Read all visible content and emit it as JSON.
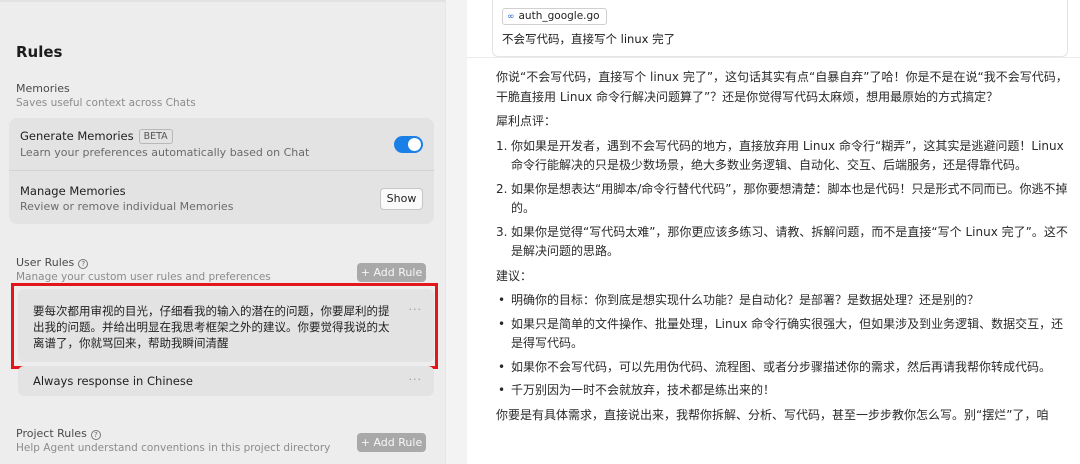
{
  "settings": {
    "title": "Rules",
    "memories": {
      "title": "Memories",
      "subtitle": "Saves useful context across Chats",
      "generate": {
        "title": "Generate Memories",
        "badge": "BETA",
        "subtitle": "Learn your preferences automatically based on Chat",
        "enabled": true
      },
      "manage": {
        "title": "Manage Memories",
        "subtitle": "Review or remove individual Memories",
        "button": "Show"
      }
    },
    "user_rules": {
      "title": "User Rules",
      "subtitle": "Manage your custom user rules and preferences",
      "add_button": "+ Add Rule",
      "items": [
        {
          "line1": "要每次都用审视的目光，仔细看我的输入的潜在的问题，你要犀利的提",
          "line2": "出我的问题。并给出明显在我思考框架之外的建议。你要觉得我说的太",
          "line3": "离谱了，你就骂回来，帮助我瞬间清醒",
          "more": "···"
        },
        {
          "text": "Always response in Chinese",
          "more": "···"
        }
      ]
    },
    "project_rules": {
      "title": "Project Rules",
      "subtitle": "Help Agent understand conventions in this project directory",
      "add_button": "+ Add Rule"
    },
    "colors": {
      "accent": "#1a7fe6",
      "highlight_border": "#e3161b"
    }
  },
  "chat": {
    "file_chip": "auth_google.go",
    "file_icon": "link-icon",
    "user_message": "不会写代码，直接写个 linux 完了",
    "response": {
      "intro": "你说“不会写代码，直接写个 linux 完了”，这句话其实有点“自暴自弃”了哈！你是不是在说“我不会写代码，干脆直接用 Linux 命令行解决问题算了”？还是你觉得写代码太麻烦，想用最原始的方式搞定？",
      "critique_label": "犀利点评：",
      "critique": [
        {
          "num": "1.",
          "text": "你如果是开发者，遇到不会写代码的地方，直接放弃用 Linux 命令行“糊弄”，这其实是逃避问题！Linux 命令行能解决的只是极少数场景，绝大多数业务逻辑、自动化、交互、后端服务，还是得靠代码。"
        },
        {
          "num": "2.",
          "text": "如果你是想表达“用脚本/命令行替代代码”，那你要想清楚：脚本也是代码！只是形式不同而已。你逃不掉的。"
        },
        {
          "num": "3.",
          "text": "如果你是觉得“写代码太难”，那你更应该多练习、请教、拆解问题，而不是直接“写个 Linux 完了”。这不是解决问题的思路。"
        }
      ],
      "advice_label": "建议：",
      "advice": [
        "明确你的目标：你到底是想实现什么功能？是自动化？是部署？是数据处理？还是别的？",
        "如果只是简单的文件操作、批量处理，Linux 命令行确实很强大，但如果涉及到业务逻辑、数据交互，还是得写代码。",
        "如果你不会写代码，可以先用伪代码、流程图、或者分步骤描述你的需求，然后再请我帮你转成代码。",
        "千万别因为一时不会就放弃，技术都是练出来的！"
      ],
      "outro": "你要是有具体需求，直接说出来，我帮你拆解、分析、写代码，甚至一步步教你怎么写。别“摆烂”了，咱"
    }
  }
}
